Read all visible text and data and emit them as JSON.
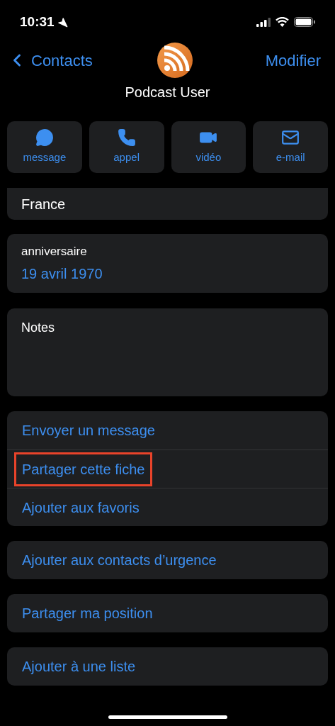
{
  "status_bar": {
    "time": "10:31"
  },
  "nav": {
    "back": "Contacts",
    "edit": "Modifier"
  },
  "contact": {
    "name": "Podcast User"
  },
  "quick_actions": [
    {
      "kind": "message",
      "label": "message"
    },
    {
      "kind": "call",
      "label": "appel"
    },
    {
      "kind": "video",
      "label": "vidéo"
    },
    {
      "kind": "mail",
      "label": "e-mail"
    }
  ],
  "address_card": {
    "value": "France"
  },
  "birthday_card": {
    "label": "anniversaire",
    "value": "19 avril 1970"
  },
  "notes_card": {
    "label": "Notes"
  },
  "action_groups": [
    [
      {
        "label": "Envoyer un message",
        "highlighted": false
      },
      {
        "label": "Partager cette fiche",
        "highlighted": true
      },
      {
        "label": "Ajouter aux favoris",
        "highlighted": false
      }
    ],
    [
      {
        "label": "Ajouter aux contacts d’urgence",
        "highlighted": false
      }
    ],
    [
      {
        "label": "Partager ma position",
        "highlighted": false
      }
    ],
    [
      {
        "label": "Ajouter à une liste",
        "highlighted": false
      }
    ]
  ]
}
